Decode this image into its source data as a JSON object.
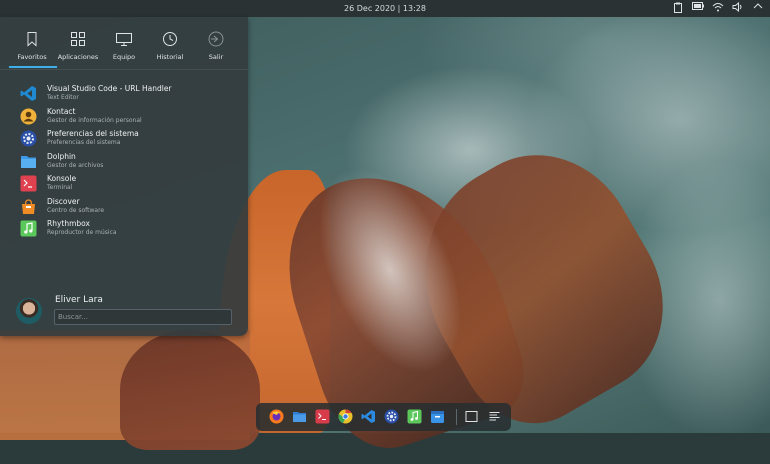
{
  "top_bar": {
    "clock": "26 Dec 2020 | 13:28",
    "tray_icons": [
      "clipboard-icon",
      "battery-icon",
      "wifi-icon",
      "volume-icon",
      "chevron-up-icon"
    ]
  },
  "launcher": {
    "tabs": [
      {
        "label": "Favoritos",
        "icon": "bookmark-icon",
        "active": true
      },
      {
        "label": "Aplicaciones",
        "icon": "grid-icon",
        "active": false
      },
      {
        "label": "Equipo",
        "icon": "monitor-icon",
        "active": false
      },
      {
        "label": "Historial",
        "icon": "clock-icon",
        "active": false
      },
      {
        "label": "Salir",
        "icon": "logout-icon",
        "active": false
      }
    ],
    "favorites": [
      {
        "name": "Visual Studio Code - URL Handler",
        "desc": "Text Editor",
        "icon": "vscode-icon",
        "color": "#1f8ad2"
      },
      {
        "name": "Kontact",
        "desc": "Gestor de información personal",
        "icon": "kontact-icon",
        "color": "#f0b13a"
      },
      {
        "name": "Preferencias del sistema",
        "desc": "Preferencias del sistema",
        "icon": "settings-icon",
        "color": "#3b6fd4"
      },
      {
        "name": "Dolphin",
        "desc": "Gestor de archivos",
        "icon": "folder-icon",
        "color": "#3d9ae8"
      },
      {
        "name": "Konsole",
        "desc": "Terminal",
        "icon": "terminal-icon",
        "color": "#e0414f"
      },
      {
        "name": "Discover",
        "desc": "Centro de software",
        "icon": "discover-icon",
        "color": "#f08a24"
      },
      {
        "name": "Rhythmbox",
        "desc": "Reproductor de música",
        "icon": "music-icon",
        "color": "#5ac85a"
      }
    ],
    "user": {
      "name": "Eliver Lara"
    },
    "search": {
      "placeholder": "Buscar..."
    }
  },
  "dock": {
    "items": [
      {
        "name": "firefox",
        "icon": "firefox-icon",
        "color": "#ff7a1a"
      },
      {
        "name": "files",
        "icon": "folder-icon",
        "color": "#3d8fe0"
      },
      {
        "name": "terminal",
        "icon": "terminal-icon",
        "color": "#d83b4a"
      },
      {
        "name": "chrome",
        "icon": "chrome-icon",
        "color": "#e8c12a"
      },
      {
        "name": "vscode",
        "icon": "vscode-icon",
        "color": "#2b8be0"
      },
      {
        "name": "settings",
        "icon": "settings-icon",
        "color": "#4a6fd0"
      },
      {
        "name": "music",
        "icon": "music-icon",
        "color": "#5cc85c"
      },
      {
        "name": "store",
        "icon": "store-icon",
        "color": "#3a93e6"
      },
      {
        "name": "window",
        "icon": "window-icon",
        "color": "#2c3336"
      },
      {
        "name": "menu",
        "icon": "menu-icon",
        "color": "#2c3336"
      }
    ]
  }
}
